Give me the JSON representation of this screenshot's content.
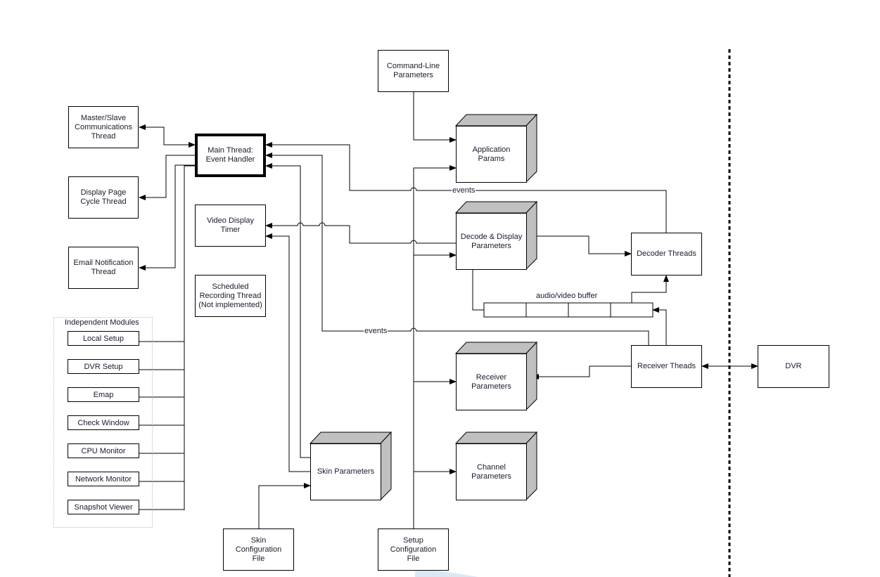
{
  "diagram": {
    "nodes": {
      "master_slave": "Master/Slave\nCommunications\nThread",
      "main_thread": "Main Thread:\nEvent Handler",
      "display_page": "Display Page\nCycle Thread",
      "email": "Email Notification\nThread",
      "video_timer": "Video Display\nTimer",
      "scheduled": "Scheduled\nRecording Thread\n(Not implemented)",
      "command_line": "Command-Line\nParameters",
      "app_params": "Application\nParams",
      "decode_display": "Decode & Display\nParameters",
      "decoder_threads": "Decoder Threads",
      "receiver_params": "Receiver\nParameters",
      "receiver_threads": "Receiver Theads",
      "dvr": "DVR",
      "channel_params": "Channel\nParameters",
      "skin_params": "Skin Parameters",
      "skin_config": "Skin\nConfiguration\nFile",
      "setup_config": "Setup\nConfiguration\nFile"
    },
    "independent_modules": {
      "title": "Independent Modules",
      "items": [
        "Local Setup",
        "DVR Setup",
        "Emap",
        "Check Window",
        "CPU Monitor",
        "Network Monitor",
        "Snapshot Viewer"
      ]
    },
    "edge_labels": {
      "events_top": "events",
      "events_mid": "events",
      "buffer": "audio/video buffer"
    },
    "colors": {
      "line": "#000000",
      "cube_shade": "#c0c0c0",
      "accent_shape": "#dbe8f3"
    }
  }
}
